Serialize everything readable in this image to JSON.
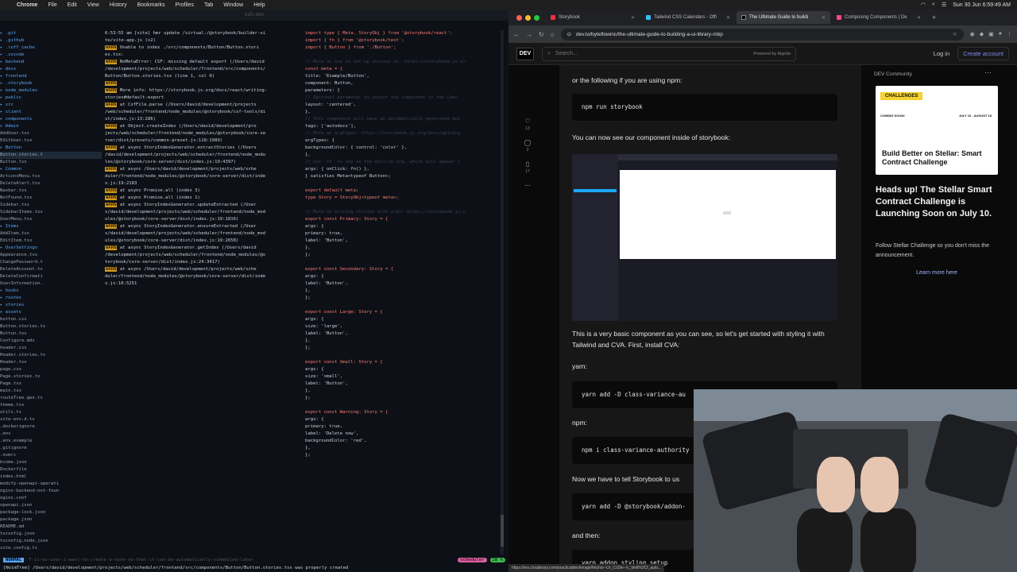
{
  "menubar": {
    "app": "Chrome",
    "items": [
      "File",
      "Edit",
      "View",
      "History",
      "Bookmarks",
      "Profiles",
      "Tab",
      "Window",
      "Help"
    ],
    "clock": "Sun 30 Jun 6:59:49 AM"
  },
  "terminal": {
    "title": "ssh:dev",
    "tree": [
      {
        "t": ".git",
        "d": true
      },
      {
        "t": ".github",
        "d": true
      },
      {
        "t": ".ruff_cache",
        "d": true
      },
      {
        "t": ".vscode",
        "d": true
      },
      {
        "t": "backend",
        "d": true
      },
      {
        "t": "docs",
        "d": true
      },
      {
        "t": "frontend",
        "d": true
      },
      {
        "t": "  .storybook",
        "d": true
      },
      {
        "t": "  node_modules",
        "d": true
      },
      {
        "t": "  public",
        "d": true
      },
      {
        "t": "  src",
        "d": true
      },
      {
        "t": "    client",
        "d": true
      },
      {
        "t": "    components",
        "d": true
      },
      {
        "t": "      Admin",
        "d": true
      },
      {
        "t": "        AddUser.tsx",
        "d": false
      },
      {
        "t": "        EditUser.tsx",
        "d": false
      },
      {
        "t": "      Button",
        "d": true
      },
      {
        "t": "        Button.stories.t",
        "d": false,
        "sel": true
      },
      {
        "t": "        Button.tsx",
        "d": false
      },
      {
        "t": "      Common",
        "d": true
      },
      {
        "t": "        ActionsMenu.tsx",
        "d": false
      },
      {
        "t": "        DeleteAlert.tsx",
        "d": false
      },
      {
        "t": "        Navbar.tsx",
        "d": false
      },
      {
        "t": "        NotFound.tsx",
        "d": false
      },
      {
        "t": "        Sidebar.tsx",
        "d": false
      },
      {
        "t": "        SidebarItems.tsx",
        "d": false
      },
      {
        "t": "        UserMenu.tsx",
        "d": false
      },
      {
        "t": "      Items",
        "d": true
      },
      {
        "t": "        AddItem.tsx",
        "d": false
      },
      {
        "t": "        EditItem.tsx",
        "d": false
      },
      {
        "t": "      UserSettings",
        "d": true
      },
      {
        "t": "        Appearance.tsx",
        "d": false
      },
      {
        "t": "        ChangePassword.t",
        "d": false
      },
      {
        "t": "        DeleteAccount.ts",
        "d": false
      },
      {
        "t": "        DeleteConfirmati",
        "d": false
      },
      {
        "t": "        UserInformation.",
        "d": false
      },
      {
        "t": "    hooks",
        "d": true
      },
      {
        "t": "    routes",
        "d": true
      },
      {
        "t": "    stories",
        "d": true
      },
      {
        "t": "      assets",
        "d": true
      },
      {
        "t": "      button.css",
        "d": false
      },
      {
        "t": "      Button.stories.ts",
        "d": false
      },
      {
        "t": "      Button.tsx",
        "d": false
      },
      {
        "t": "      Configure.mdx",
        "d": false
      },
      {
        "t": "      header.css",
        "d": false
      },
      {
        "t": "      Header.stories.ts",
        "d": false
      },
      {
        "t": "      Header.tsx",
        "d": false
      },
      {
        "t": "      page.css",
        "d": false
      },
      {
        "t": "      Page.stories.ts",
        "d": false
      },
      {
        "t": "      Page.tsx",
        "d": false
      },
      {
        "t": "    main.tsx",
        "d": false
      },
      {
        "t": "    routeTree.gen.ts",
        "d": false
      },
      {
        "t": "    theme.tsx",
        "d": false
      },
      {
        "t": "    utils.ts",
        "d": false
      },
      {
        "t": "    vite-env.d.ts",
        "d": false
      },
      {
        "t": "  .dockerignore",
        "d": false
      },
      {
        "t": "  .env",
        "d": false
      },
      {
        "t": "  .env.example",
        "d": false
      },
      {
        "t": "  .gitignore",
        "d": false
      },
      {
        "t": "  .nvmrc",
        "d": false
      },
      {
        "t": "  biome.json",
        "d": false
      },
      {
        "t": "  Dockerfile",
        "d": false
      },
      {
        "t": "  index.html",
        "d": false
      },
      {
        "t": "  modify-openapi-operati",
        "d": false
      },
      {
        "t": "  nginx-backend-not-foun",
        "d": false
      },
      {
        "t": "  nginx.conf",
        "d": false
      },
      {
        "t": "  openapi.json",
        "d": false
      },
      {
        "t": "  package-lock.json",
        "d": false
      },
      {
        "t": "  package.json",
        "d": false
      },
      {
        "t": "  README.md",
        "d": false
      },
      {
        "t": "  tsconfig.json",
        "d": false
      },
      {
        "t": "  tsconfig.node.json",
        "d": false
      },
      {
        "t": "  vite.config.ts",
        "d": false
      }
    ],
    "log": [
      {
        "w": false,
        "t": "6:53:55 am [vite] hmr update /virtual:/@storybook/builder-vi"
      },
      {
        "w": false,
        "t": "te/vite-app.js (x2)"
      },
      {
        "w": true,
        "t": " Unable to index ./src/components/Button/Button.stori"
      },
      {
        "w": false,
        "t": "es.tsx:"
      },
      {
        "w": true,
        "t": "   NoMetaError: CSF: missing default export (/Users/david"
      },
      {
        "w": false,
        "t": "/development/projects/web/scheduler/frontend/src/components/"
      },
      {
        "w": false,
        "t": "Button/Button.stories.tsx (line 1, col 0)"
      },
      {
        "w": true,
        "t": ""
      },
      {
        "w": true,
        "t": "   More info: https://storybook.js.org/docs/react/writing-"
      },
      {
        "w": false,
        "t": "stories#default-export"
      },
      {
        "w": true,
        "t": "       at CsfFile.parse (/Users/david/development/projects"
      },
      {
        "w": false,
        "t": "/web/scheduler/frontend/node_modules/@storybook/csf-tools/di"
      },
      {
        "w": false,
        "t": "st/index.js:13:286)"
      },
      {
        "w": true,
        "t": "       at Object.createIndex (/Users/david/development/pro"
      },
      {
        "w": false,
        "t": "jects/web/scheduler/frontend/node_modules/@storybook/core-se"
      },
      {
        "w": false,
        "t": "rver/dist/presets/common-preset.js:118:1989)"
      },
      {
        "w": true,
        "t": "       at async StoryIndexGenerator.extractStories (/Users"
      },
      {
        "w": false,
        "t": "/david/development/projects/web/scheduler/frontend/node_modu"
      },
      {
        "w": false,
        "t": "les/@storybook/core-server/dist/index.js:19:4397)"
      },
      {
        "w": true,
        "t": "       at async /Users/david/development/projects/web/sche"
      },
      {
        "w": false,
        "t": "duler/frontend/node_modules/@storybook/core-server/dist/inde"
      },
      {
        "w": false,
        "t": "x.js:19:2183"
      },
      {
        "w": true,
        "t": "       at async Promise.all (index 3)"
      },
      {
        "w": true,
        "t": "       at async Promise.all (index 1)"
      },
      {
        "w": true,
        "t": "       at async StoryIndexGenerator.updateExtracted (/User"
      },
      {
        "w": false,
        "t": "s/david/development/projects/web/scheduler/frontend/node_mod"
      },
      {
        "w": false,
        "t": "ules/@storybook/core-server/dist/index.js:19:1816)"
      },
      {
        "w": true,
        "t": "       at async StoryIndexGenerator.ensureExtracted (/User"
      },
      {
        "w": false,
        "t": "s/david/development/projects/web/scheduler/frontend/node_mod"
      },
      {
        "w": false,
        "t": "ules/@storybook/core-server/dist/index.js:19:2658)"
      },
      {
        "w": true,
        "t": "       at async StoryIndexGenerator.getIndex (/Users/david"
      },
      {
        "w": false,
        "t": "/development/projects/web/scheduler/frontend/node_modules/@s"
      },
      {
        "w": false,
        "t": "torybook/core-server/dist/index.js:24:3417)"
      },
      {
        "w": true,
        "t": "       at async /Users/david/development/projects/web/sche"
      },
      {
        "w": false,
        "t": "duler/frontend/node_modules/@storybook/core-server/dist/inde"
      },
      {
        "w": false,
        "t": "x.js:16:5251"
      }
    ],
    "code": [
      "import type { Meta, StoryObj } from '@storybook/react';",
      "import { fn } from '@storybook/test';",
      "import { Button } from './Button';",
      "",
      "// More on how to set up stories at: https://storybook.js.or",
      "const meta = {",
      "  title: 'Example/Button',",
      "  component: Button,",
      "  parameters: {",
      "    // Optional parameter to center the component in the Canv",
      "    layout: 'centered',",
      "  },",
      "  // This component will have an automatically generated Aut",
      "  tags: ['autodocs'],",
      "  // More on argTypes: https://storybook.js.org/docs/api/arg",
      "  argTypes: {",
      "    backgroundColor: { control: 'color' },",
      "  },",
      "  // Use `fn` to spy on the onClick arg, which will appear i",
      "  args: { onClick: fn() },",
      "} satisfies Meta<typeof Button>;",
      "",
      "export default meta;",
      "type Story = StoryObj<typeof meta>;",
      "",
      "// More on writing stories with args: https://storybook.js.o",
      "export const Primary: Story = {",
      "  args: {",
      "    primary: true,",
      "    label: 'Button',",
      "  },",
      "};",
      "",
      "export const Secondary: Story = {",
      "  args: {",
      "    label: 'Button',",
      "  },",
      "};",
      "",
      "export const Large: Story = {",
      "  args: {",
      "    size: 'large',",
      "    label: 'Button',",
      "  },",
      "};",
      "",
      "export const Small: Story = {",
      "  args: {",
      "    size: 'small',",
      "    label: 'Button',",
      "  },",
      "};",
      "",
      "export const Warning: Story = {",
      "  args: {",
      "    primary: true,",
      "    label: 'Delete now',",
      "    backgroundColor: 'red',",
      "  },",
      "};"
    ],
    "status": {
      "mode": "NORMAL",
      "branch": "scheduler",
      "percent": "28 %"
    },
    "cmdline": "[NvimTree] /Users/david/development/projects/web/scheduler/frontend/src/components/Button/Button.stories.tsx was properly created",
    "cmd_hint": "T-is-as-user-i-want-to-create-a-task-so-that-it-can-be-automatically-scheduled-later"
  },
  "browser": {
    "tabs": [
      {
        "label": "Storybook",
        "active": false
      },
      {
        "label": "Tailwind CSS Calendars - Offi",
        "active": false
      },
      {
        "label": "The Ultimate Guide to buildi",
        "active": true
      },
      {
        "label": "Composing Components | De",
        "active": false
      }
    ],
    "url": "dev.to/byteflowinc/the-ultimate-guide-to-building-a-ui-library-mbp",
    "devto": {
      "logo": "DEV",
      "search_placeholder": "Search...",
      "powered": "Powered by Algolia",
      "login": "Log in",
      "create": "Create account"
    },
    "reactions": [
      "13",
      "2",
      "17"
    ],
    "article": {
      "p1": "or the following if you are using npm:",
      "code1": "npm run storybook",
      "p2": "You can now see our component inside of storybook:",
      "p3": "This is a very basic component as you can see, so let's get started with styling it with Tailwind and CVA. First, install CVA:",
      "yarn_label": "yarn:",
      "code2": "yarn add -D class-variance-au",
      "npm_label": "npm:",
      "code3": "npm i class-variance-authority",
      "p4": "Now we have to tell Storybook to us",
      "code4": "yarn add -D @storybook/addon-",
      "then": "and then:",
      "code5": "yarn addon styling setup"
    },
    "sidebar": {
      "community": "DEV Community",
      "banner": "CHALLENGES",
      "coming": "COMING SOON!",
      "dates": "JULY 10 - AUGUST 18",
      "card_headline": "Build Better on Stellar: Smart Contract Challenge",
      "title": "Heads up! The Stellar Smart Contract Challenge is Launching Soon on July 10.",
      "body": "Follow Stellar Challenge so you don't miss the announcement.",
      "learn": "Learn more here"
    },
    "status_url": "https://res.cloudinary.com/practicaldev/image/fetch/s--Ur_Cr29v--/c_limit%2Cf_auto..."
  }
}
